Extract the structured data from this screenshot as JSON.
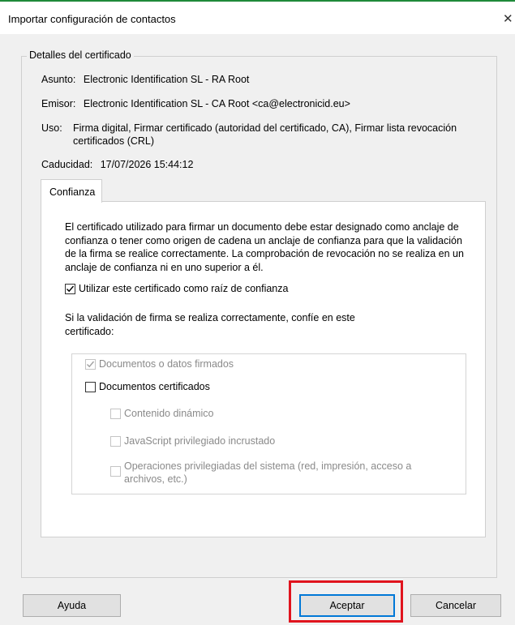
{
  "window": {
    "title": "Importar configuración de contactos",
    "close_glyph": "✕"
  },
  "details": {
    "legend": "Detalles del certificado",
    "subject_label": "Asunto:",
    "subject_value": "Electronic Identification SL - RA Root",
    "issuer_label": "Emisor:",
    "issuer_value": "Electronic Identification SL - CA Root <ca@electronicid.eu>",
    "usage_label": "Uso:",
    "usage_value_line1": "Firma digital, Firmar certificado (autoridad del certificado, CA), Firmar lista revocación",
    "usage_value_line2": "certificados (CRL)",
    "expiry_label": "Caducidad:",
    "expiry_value": "17/07/2026 15:44:12"
  },
  "tab": {
    "label": "Confianza"
  },
  "trust": {
    "description": "El certificado utilizado para firmar un documento debe estar designado como anclaje de confianza o tener como origen de cadena un anclaje de confianza para que la validación de la firma se realice correctamente. La comprobación de revocación no se realiza en un anclaje de confianza ni en uno superior a él.",
    "use_as_root_label": "Utilizar este certificado como raíz de confianza",
    "use_as_root_checked": true,
    "trust_intro": "Si la validación de firma se realiza correctamente, confíe en este certificado:",
    "options": {
      "signed_docs_label": "Documentos o datos firmados",
      "signed_docs_checked": true,
      "signed_docs_enabled": false,
      "certified_docs_label": "Documentos certificados",
      "certified_docs_checked": false,
      "certified_docs_enabled": true,
      "dynamic_content_label": "Contenido dinámico",
      "embedded_js_label": "JavaScript privilegiado incrustado",
      "system_ops_label_line1": "Operaciones privilegiadas del sistema (red, impresión, acceso a",
      "system_ops_label_line2": "archivos, etc.)"
    }
  },
  "buttons": {
    "help": "Ayuda",
    "accept": "Aceptar",
    "cancel": "Cancelar"
  },
  "colors": {
    "dialog_bg": "#f0f0f0",
    "panel_bg": "#ffffff",
    "focus_blue": "#0078d7",
    "highlight_red": "#e0141e",
    "top_accent": "#1f8a3a"
  }
}
